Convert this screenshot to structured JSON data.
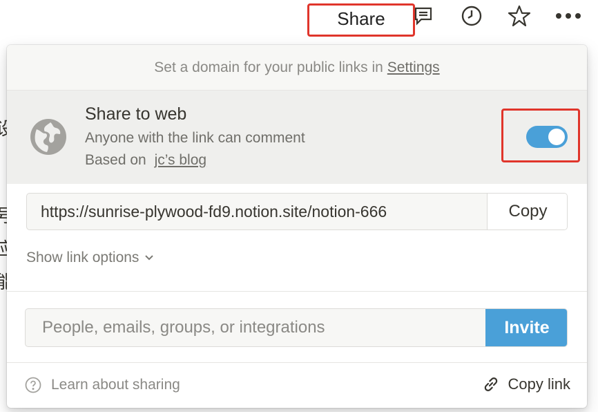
{
  "topbar": {
    "share_label": "Share",
    "icons": [
      "comment-icon",
      "clock-icon",
      "star-icon",
      "more-icon"
    ]
  },
  "background_text": [
    "设",
    "号",
    "应",
    "能"
  ],
  "popover": {
    "domain_notice": "Set a domain for your public links in",
    "domain_notice_link": "Settings",
    "share_to_web": {
      "title": "Share to web",
      "subtitle": "Anyone with the link can comment",
      "based_on_prefix": "Based on",
      "based_on_link": "jc’s blog",
      "toggle_on": true
    },
    "url": {
      "value": "https://sunrise-plywood-fd9.notion.site/notion-666",
      "copy_label": "Copy"
    },
    "show_link_options": "Show link options",
    "invite": {
      "placeholder": "People, emails, groups, or integrations",
      "button_label": "Invite"
    },
    "footer": {
      "learn_label": "Learn about sharing",
      "copy_link_label": "Copy link"
    }
  },
  "colors": {
    "accent": "#4aa0d8",
    "highlight": "#e0352b"
  }
}
